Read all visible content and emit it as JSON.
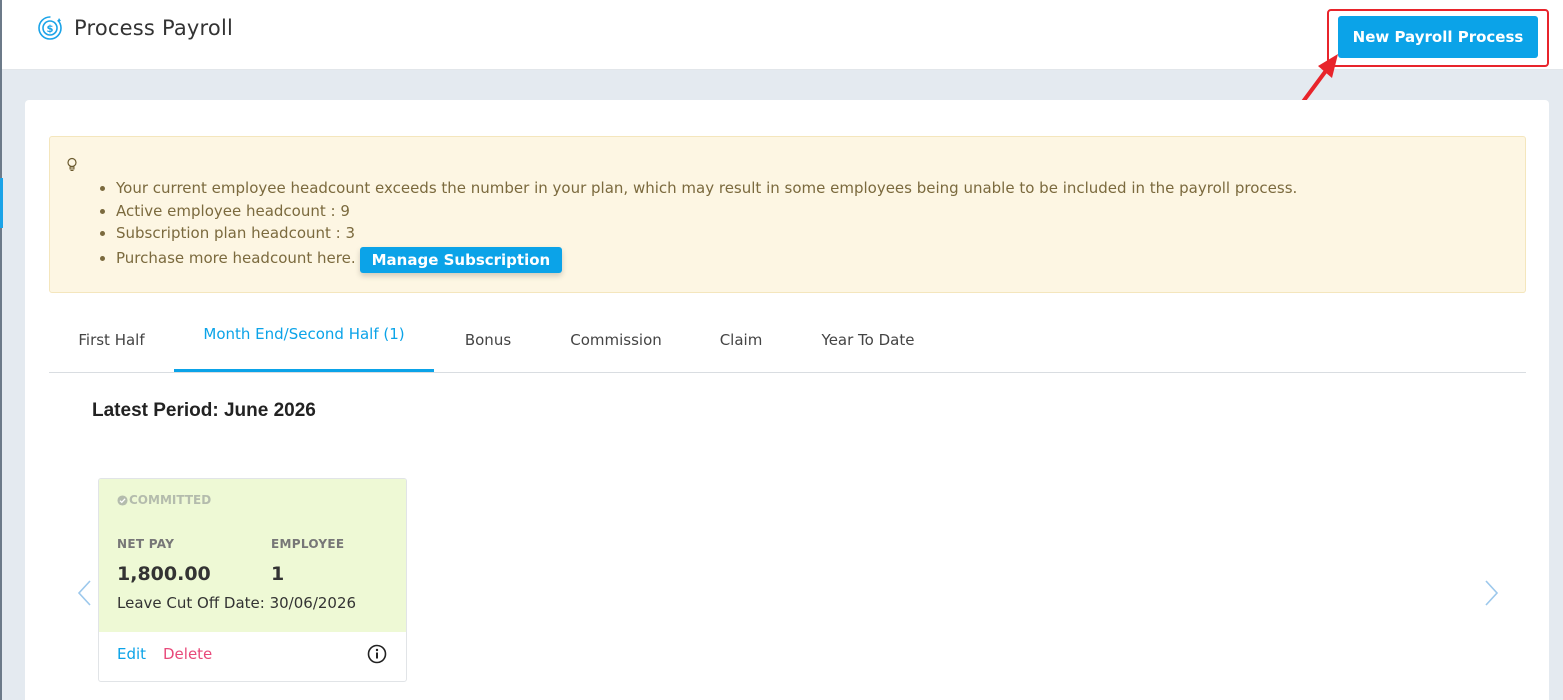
{
  "header": {
    "title": "Process Payroll",
    "title_icon": "payroll-cycle-icon",
    "new_button_label": "New Payroll Process"
  },
  "alert": {
    "icon": "lightbulb-icon",
    "items": [
      "Your current employee headcount exceeds the number in your plan, which may result in some employees being unable to be included in the payroll process.",
      "Active employee headcount : 9",
      "Subscription plan headcount : 3",
      "Purchase more headcount here."
    ],
    "manage_button_label": "Manage Subscription"
  },
  "tabs": [
    {
      "label": "First Half",
      "active": false
    },
    {
      "label": "Month End/Second Half (1)",
      "active": true
    },
    {
      "label": "Bonus",
      "active": false
    },
    {
      "label": "Commission",
      "active": false
    },
    {
      "label": "Claim",
      "active": false
    },
    {
      "label": "Year To Date",
      "active": false
    }
  ],
  "period": {
    "title": "Latest Period: June 2026"
  },
  "payroll_card": {
    "status": "COMMITTED",
    "net_pay_label": "NET PAY",
    "net_pay_value": "1,800.00",
    "employee_label": "EMPLOYEE",
    "employee_value": "1",
    "leave_cutoff": "Leave Cut Off Date: 30/06/2026",
    "edit_label": "Edit",
    "delete_label": "Delete"
  },
  "colors": {
    "primary": "#0ba3e8",
    "alert_bg": "#fdf6e3",
    "card_committed_bg": "#eef9d5",
    "delete": "#e8497a",
    "highlight": "#e8242b"
  }
}
